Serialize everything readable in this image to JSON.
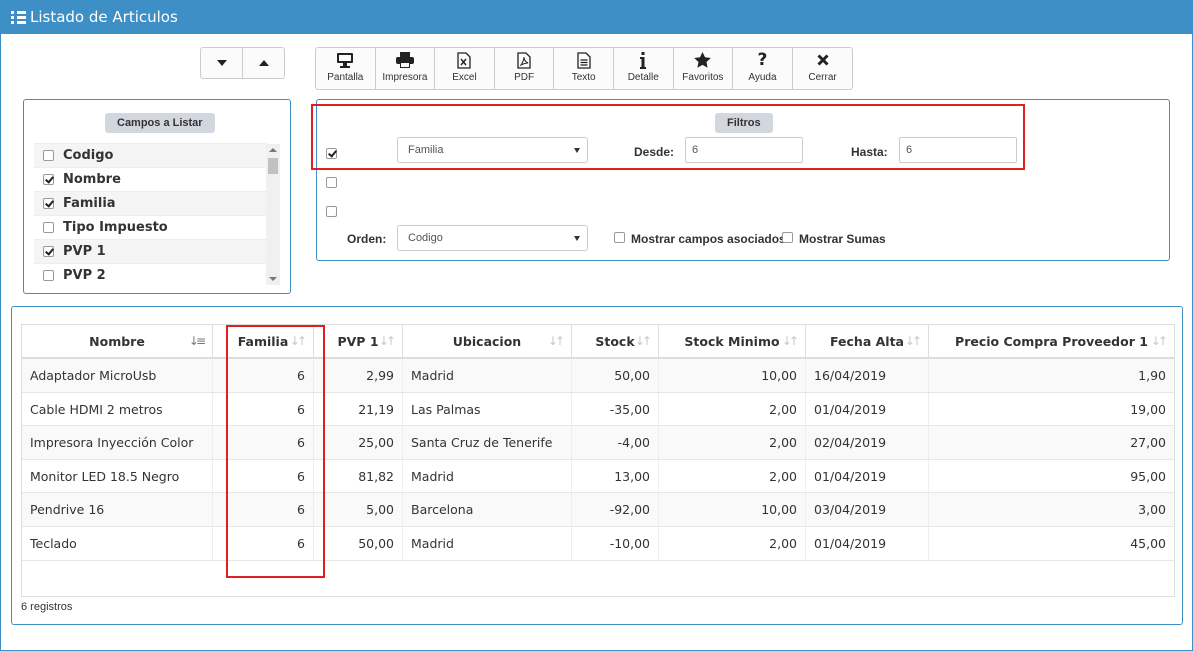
{
  "window": {
    "title": "Listado de Articulos"
  },
  "toolbar": [
    {
      "label": "Pantalla",
      "icon": "monitor-icon"
    },
    {
      "label": "Impresora",
      "icon": "printer-icon"
    },
    {
      "label": "Excel",
      "icon": "excel-icon"
    },
    {
      "label": "PDF",
      "icon": "pdf-icon"
    },
    {
      "label": "Texto",
      "icon": "text-file-icon"
    },
    {
      "label": "Detalle",
      "icon": "info-icon"
    },
    {
      "label": "Favoritos",
      "icon": "star-icon"
    },
    {
      "label": "Ayuda",
      "icon": "question-icon"
    },
    {
      "label": "Cerrar",
      "icon": "close-icon"
    }
  ],
  "fields": {
    "title": "Campos a Listar",
    "items": [
      {
        "label": "Codigo",
        "checked": false
      },
      {
        "label": "Nombre",
        "checked": true
      },
      {
        "label": "Familia",
        "checked": true
      },
      {
        "label": "Tipo Impuesto",
        "checked": false
      },
      {
        "label": "PVP 1",
        "checked": true
      },
      {
        "label": "PVP 2",
        "checked": false
      }
    ]
  },
  "filters": {
    "title": "Filtros",
    "row1": {
      "checked": true,
      "field": "Familia",
      "desde_label": "Desde:",
      "desde_value": "6",
      "hasta_label": "Hasta:",
      "hasta_value": "6"
    },
    "row2": {
      "checked": false
    },
    "row3": {
      "checked": false
    },
    "orden_label": "Orden:",
    "orden_value": "Codigo",
    "asociados_label": "Mostrar campos asociados",
    "sumas_label": "Mostrar Sumas"
  },
  "table": {
    "columns": [
      "Nombre",
      "Familia",
      "PVP 1",
      "Ubicacion",
      "Stock",
      "Stock Minimo",
      "Fecha Alta",
      "Precio Compra Proveedor 1"
    ],
    "rows": [
      [
        "Adaptador MicroUsb",
        "6",
        "2,99",
        "Madrid",
        "50,00",
        "10,00",
        "16/04/2019",
        "1,90"
      ],
      [
        "Cable HDMI 2 metros",
        "6",
        "21,19",
        "Las Palmas",
        "-35,00",
        "2,00",
        "01/04/2019",
        "19,00"
      ],
      [
        "Impresora Inyección Color",
        "6",
        "25,00",
        "Santa Cruz de Tenerife",
        "-4,00",
        "2,00",
        "02/04/2019",
        "27,00"
      ],
      [
        "Monitor LED 18.5 Negro",
        "6",
        "81,82",
        "Madrid",
        "13,00",
        "2,00",
        "01/04/2019",
        "95,00"
      ],
      [
        "Pendrive 16",
        "6",
        "5,00",
        "Barcelona",
        "-92,00",
        "10,00",
        "03/04/2019",
        "3,00"
      ],
      [
        "Teclado",
        "6",
        "50,00",
        "Madrid",
        "-10,00",
        "2,00",
        "01/04/2019",
        "45,00"
      ]
    ],
    "count_text": "6 registros"
  },
  "colors": {
    "accent": "#3d8fc5",
    "highlight": "#e02020"
  }
}
